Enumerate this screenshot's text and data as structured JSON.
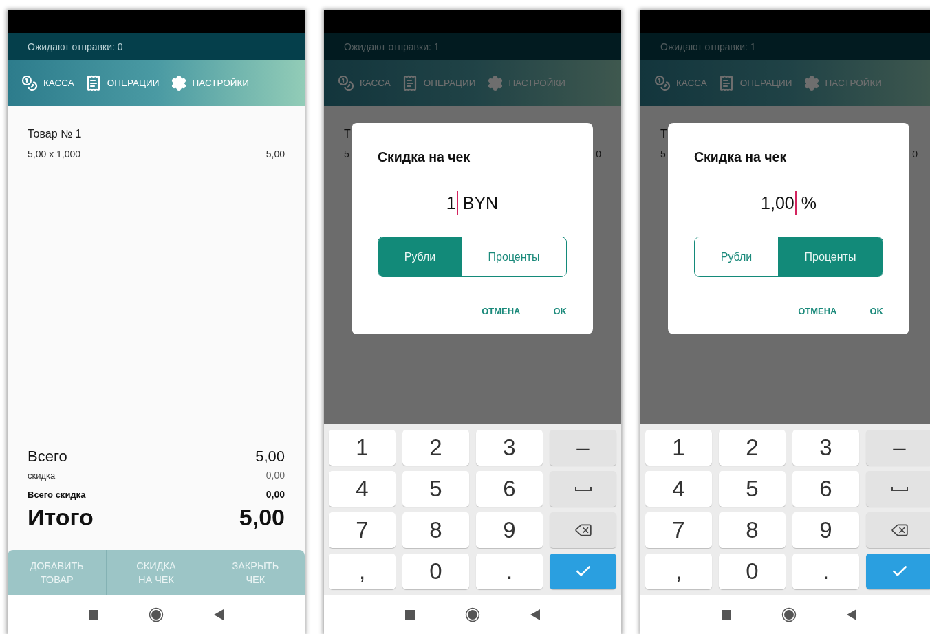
{
  "screens": [
    {
      "pending": "Ожидают отправки: 0",
      "tabs": [
        {
          "label": "КАССА"
        },
        {
          "label": "ОПЕРАЦИИ"
        },
        {
          "label": "НАСТРОЙКИ"
        }
      ],
      "item": {
        "name": "Товар № 1",
        "qty": "5,00 x 1,000",
        "sum": "5,00"
      },
      "totals": {
        "subtotal_label": "Всего",
        "subtotal": "5,00",
        "discount_label": "скидка",
        "discount": "0,00",
        "total_discount_label": "Всего скидка",
        "total_discount": "0,00",
        "total_label": "Итого",
        "total": "5,00"
      },
      "actions": [
        [
          "ДОБАВИТЬ",
          "ТОВАР"
        ],
        [
          "СКИДКА",
          "НА ЧЕК"
        ],
        [
          "ЗАКРЫТЬ",
          "ЧЕК"
        ]
      ]
    },
    {
      "pending": "Ожидают отправки: 1",
      "tabs": [
        {
          "label": "КАССА"
        },
        {
          "label": "ОПЕРАЦИИ"
        },
        {
          "label": "НАСТРОЙКИ"
        }
      ],
      "item": {
        "name": "Т",
        "qty": "5",
        "sum": "0"
      },
      "dialog": {
        "title": "Скидка на чек",
        "value": "1",
        "unit": "BYN",
        "options": [
          {
            "label": "Рубли",
            "selected": true
          },
          {
            "label": "Проценты",
            "selected": false
          }
        ],
        "buttons": [
          "ОТМЕНА",
          "OK"
        ]
      },
      "keyboard": [
        {
          "kind": "digit",
          "label": "1"
        },
        {
          "kind": "digit",
          "label": "2"
        },
        {
          "kind": "digit",
          "label": "3"
        },
        {
          "kind": "symbol",
          "label": "–"
        },
        {
          "kind": "digit",
          "label": "4"
        },
        {
          "kind": "digit",
          "label": "5"
        },
        {
          "kind": "digit",
          "label": "6"
        },
        {
          "kind": "space"
        },
        {
          "kind": "digit",
          "label": "7"
        },
        {
          "kind": "digit",
          "label": "8"
        },
        {
          "kind": "digit",
          "label": "9"
        },
        {
          "kind": "backspace"
        },
        {
          "kind": "digit",
          "label": ","
        },
        {
          "kind": "digit",
          "label": "0"
        },
        {
          "kind": "digit",
          "label": "."
        },
        {
          "kind": "done"
        }
      ]
    },
    {
      "pending": "Ожидают отправки: 1",
      "tabs": [
        {
          "label": "КАССА"
        },
        {
          "label": "ОПЕРАЦИИ"
        },
        {
          "label": "НАСТРОЙКИ"
        }
      ],
      "item": {
        "name": "Т",
        "qty": "5",
        "sum": "0"
      },
      "dialog": {
        "title": "Скидка на чек",
        "value": "1,00",
        "unit": "%",
        "options": [
          {
            "label": "Рубли",
            "selected": false
          },
          {
            "label": "Проценты",
            "selected": true
          }
        ],
        "buttons": [
          "ОТМЕНА",
          "OK"
        ]
      },
      "keyboard": [
        {
          "kind": "digit",
          "label": "1"
        },
        {
          "kind": "digit",
          "label": "2"
        },
        {
          "kind": "digit",
          "label": "3"
        },
        {
          "kind": "symbol",
          "label": "–"
        },
        {
          "kind": "digit",
          "label": "4"
        },
        {
          "kind": "digit",
          "label": "5"
        },
        {
          "kind": "digit",
          "label": "6"
        },
        {
          "kind": "space"
        },
        {
          "kind": "digit",
          "label": "7"
        },
        {
          "kind": "digit",
          "label": "8"
        },
        {
          "kind": "digit",
          "label": "9"
        },
        {
          "kind": "backspace"
        },
        {
          "kind": "digit",
          "label": ","
        },
        {
          "kind": "digit",
          "label": "0"
        },
        {
          "kind": "digit",
          "label": "."
        },
        {
          "kind": "done"
        }
      ]
    }
  ]
}
